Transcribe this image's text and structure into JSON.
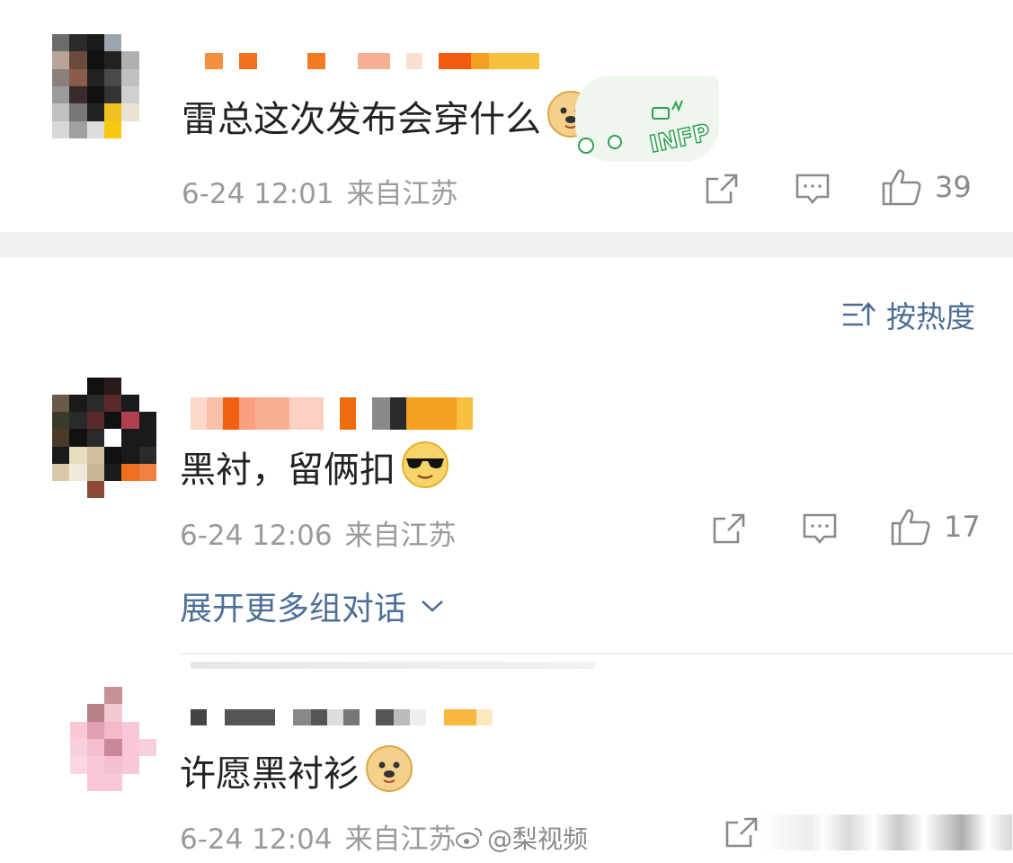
{
  "comments": [
    {
      "content": "雷总这次发布会穿什么",
      "time": "6-24 12:01",
      "location": "来自江苏",
      "likes": "39",
      "sticker": "INFP",
      "emoji": "doge-emoji"
    },
    {
      "content": "黑衬，留俩扣",
      "time": "6-24 12:06",
      "location": "来自江苏",
      "likes": "17",
      "emoji": "cool-sunglasses-emoji"
    },
    {
      "content": "许愿黑衬衫",
      "time": "6-24 12:04",
      "location": "来自江苏",
      "likes": "",
      "emoji": "doge-emoji"
    }
  ],
  "sort": {
    "label": "按热度",
    "icon": "sort-icon"
  },
  "expand": {
    "label": "展开更多组对话",
    "icon": "chevron-down-icon"
  },
  "watermark": {
    "text": "@梨视频",
    "icon": "weibo-logo"
  },
  "colors": {
    "link": "#4e6f96",
    "meta": "#9a9a9a",
    "band": "#f1f1f1"
  }
}
